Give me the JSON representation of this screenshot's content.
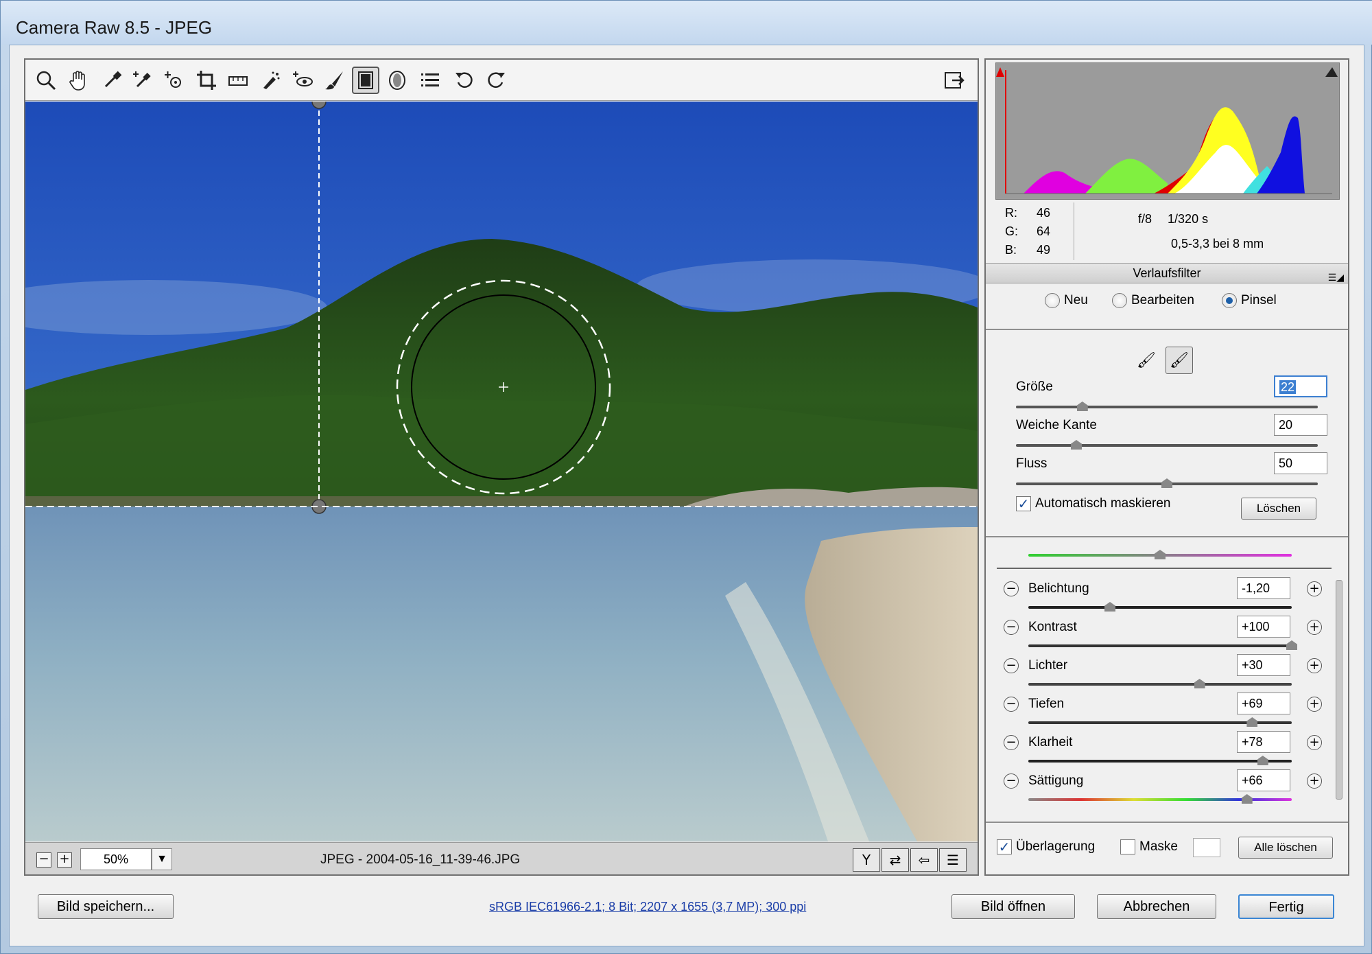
{
  "window": {
    "title": "Camera Raw 8.5 - JPEG"
  },
  "toolbar": {
    "tools": [
      "zoom-icon",
      "hand-icon",
      "eyedropper-icon",
      "color-sampler-icon",
      "targeted-adjustment-icon",
      "crop-icon",
      "straighten-icon",
      "spot-removal-icon",
      "red-eye-icon",
      "adjustment-brush-icon",
      "graduated-filter-icon",
      "radial-filter-icon",
      "preferences-icon",
      "rotate-left-icon",
      "rotate-right-icon"
    ],
    "fullscreen_icon": "fullscreen-toggle-icon"
  },
  "status": {
    "zoom": "50%",
    "filename": "JPEG - 2004-05-16_11-39-46.JPG"
  },
  "readout": {
    "r_label": "R:",
    "r_value": "46",
    "g_label": "G:",
    "g_value": "64",
    "b_label": "B:",
    "b_value": "49",
    "aperture": "f/8",
    "shutter": "1/320 s",
    "lens": "0,5-3,3 bei 8 mm"
  },
  "panel": {
    "title": "Verlaufsfilter",
    "modes": [
      {
        "label": "Neu",
        "selected": false
      },
      {
        "label": "Bearbeiten",
        "selected": false
      },
      {
        "label": "Pinsel",
        "selected": true
      }
    ]
  },
  "brush": {
    "size_label": "Größe",
    "size_value": "22",
    "size_level": 22,
    "feather_label": "Weiche Kante",
    "feather_value": "20",
    "feather_level": 20,
    "flow_label": "Fluss",
    "flow_value": "50",
    "flow_level": 50,
    "auto_mask_label": "Automatisch maskieren",
    "auto_mask_checked": true,
    "clear_label": "Löschen"
  },
  "adjustments": [
    {
      "label": "Belichtung",
      "value": "-1,20",
      "level": 0.31
    },
    {
      "label": "Kontrast",
      "value": "+100",
      "level": 1.0
    },
    {
      "label": "Lichter",
      "value": "+30",
      "level": 0.65
    },
    {
      "label": "Tiefen",
      "value": "+69",
      "level": 0.85
    },
    {
      "label": "Klarheit",
      "value": "+78",
      "level": 0.89
    },
    {
      "label": "Sättigung",
      "value": "+66",
      "level": 0.83
    }
  ],
  "tint_level": 0.5,
  "options": {
    "overlay_label": "Überlagerung",
    "overlay_checked": true,
    "mask_label": "Maske",
    "mask_checked": false,
    "clear_all_label": "Alle löschen"
  },
  "footer": {
    "save_label": "Bild speichern...",
    "workflow_link": "sRGB IEC61966-2.1; 8 Bit; 2207 x 1655 (3,7 MP); 300 ppi",
    "open_label": "Bild öffnen",
    "cancel_label": "Abbrechen",
    "done_label": "Fertig"
  }
}
